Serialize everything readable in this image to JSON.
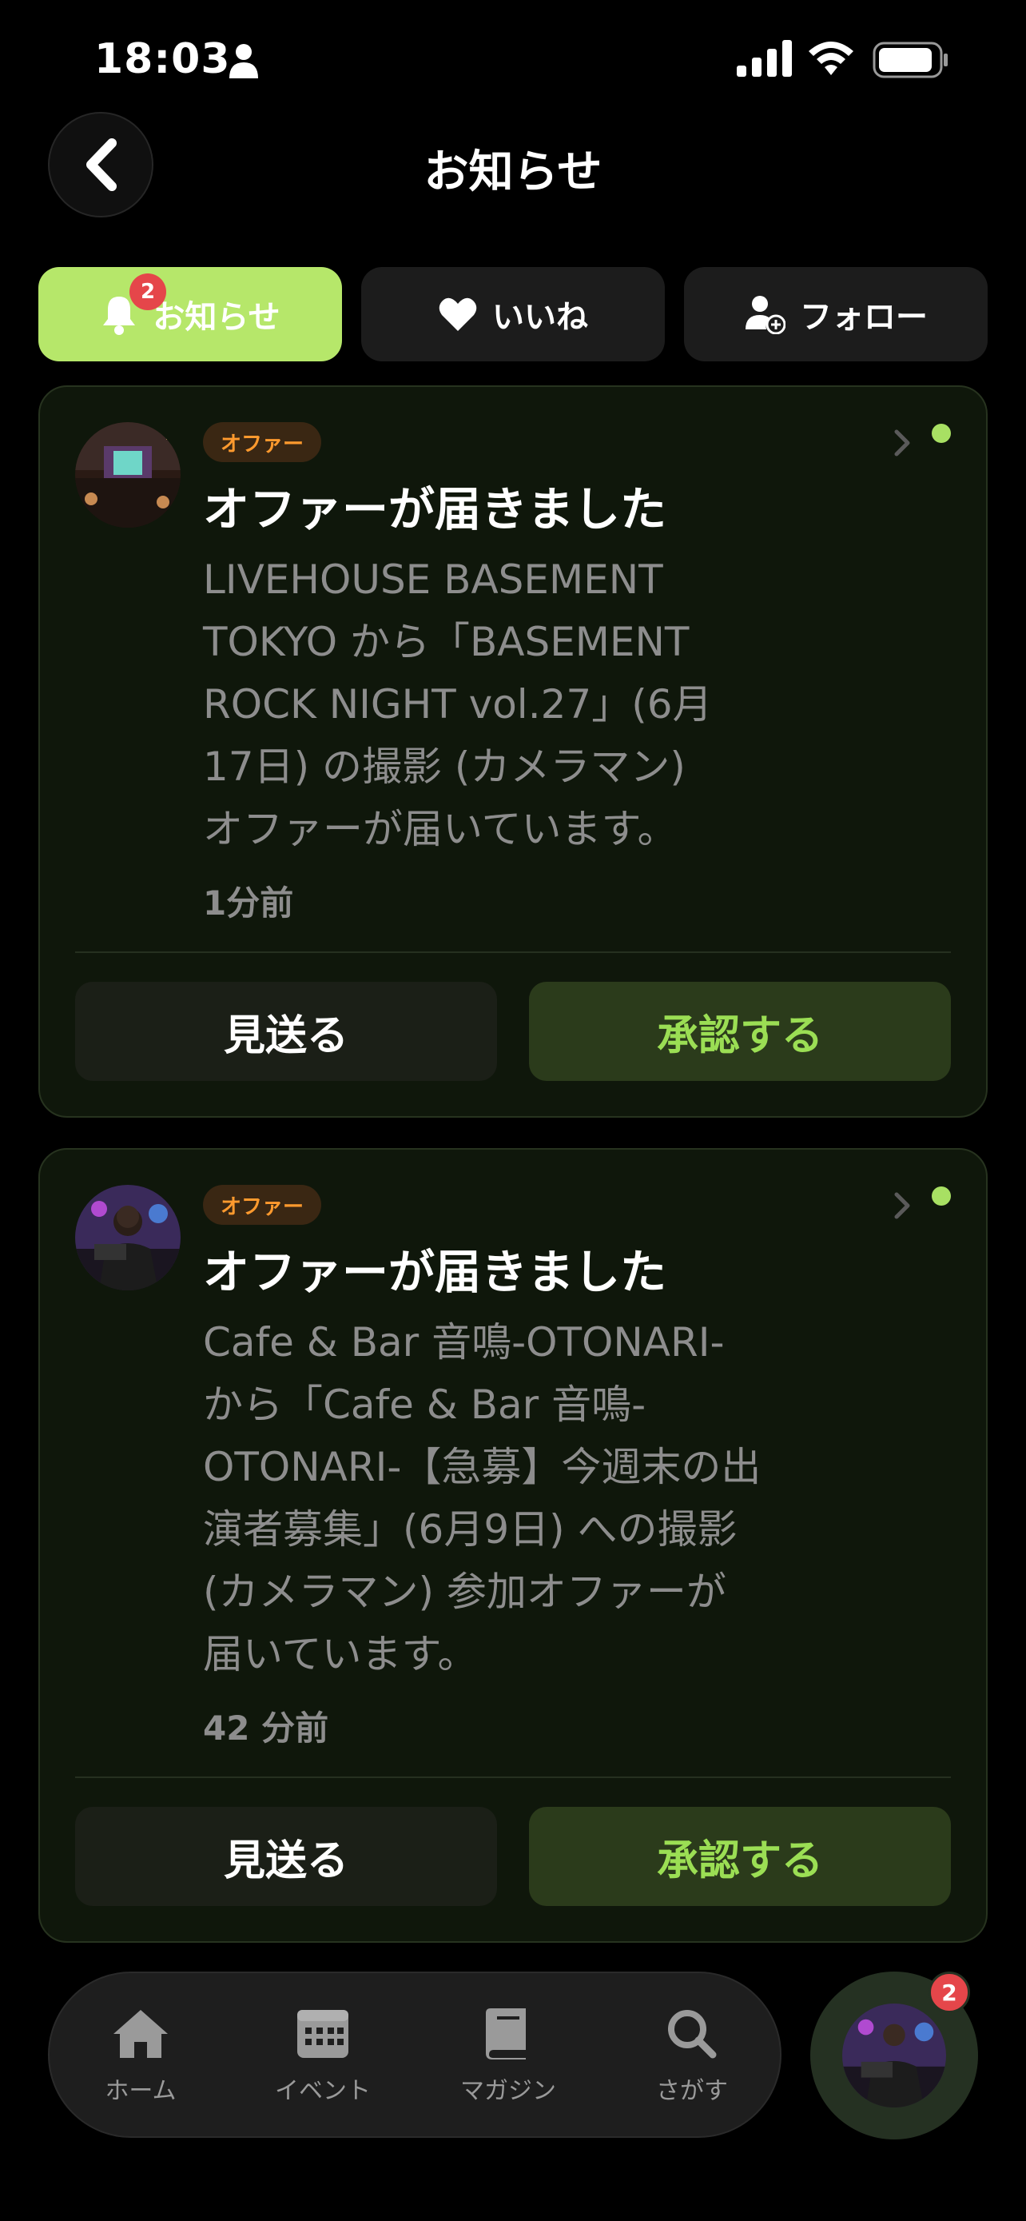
{
  "status_bar": {
    "time": "18:03"
  },
  "header": {
    "title": "お知らせ"
  },
  "tabs": [
    {
      "label": "お知らせ",
      "badge": "2",
      "icon": "bell-icon",
      "active": true
    },
    {
      "label": "いいね",
      "icon": "heart-icon",
      "active": false
    },
    {
      "label": "フォロー",
      "icon": "person-add-icon",
      "active": false
    }
  ],
  "notifications": [
    {
      "badge": "オファー",
      "title": "オファーが届きました",
      "body": "LIVEHOUSE BASEMENT\nTOKYO から「BASEMENT\nROCK NIGHT vol.27」(6月\n17日) の撮影 (カメラマン)\nオファーが届いています。",
      "time": "1分前",
      "skip_label": "見送る",
      "accept_label": "承認する"
    },
    {
      "badge": "オファー",
      "title": "オファーが届きました",
      "body": "Cafe & Bar 音鳴-OTONARI-\nから「Cafe & Bar 音鳴-\nOTONARI-【急募】今週末の出\n演者募集」(6月9日) への撮影\n(カメラマン) 参加オファーが\n届いています。",
      "time": "42 分前",
      "skip_label": "見送る",
      "accept_label": "承認する"
    }
  ],
  "bottom_nav": {
    "items": [
      {
        "label": "ホーム",
        "icon": "home-icon"
      },
      {
        "label": "イベント",
        "icon": "calendar-icon"
      },
      {
        "label": "マガジン",
        "icon": "book-icon"
      },
      {
        "label": "さがす",
        "icon": "search-icon"
      }
    ],
    "profile_badge": "2"
  },
  "colors": {
    "accent": "#b6e76a",
    "offer": "#ff9a2e",
    "badge": "#e5464a"
  }
}
